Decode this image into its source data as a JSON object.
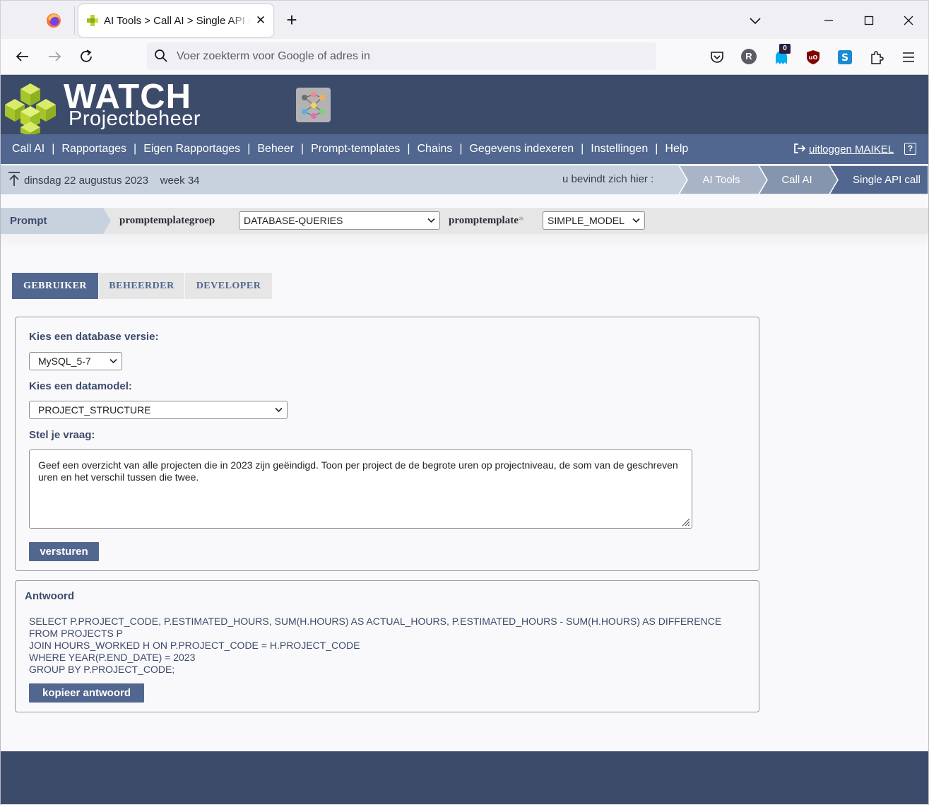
{
  "browser": {
    "tab_title": "AI Tools > Call AI > Single API call",
    "url_placeholder": "Voer zoekterm voor Google of adres in",
    "notification_count": "0",
    "account_initial": "R"
  },
  "header": {
    "logo_title": "WATCH",
    "logo_subtitle": "Projectbeheer"
  },
  "menu": {
    "items": [
      "Call AI",
      "Rapportages",
      "Eigen Rapportages",
      "Beheer",
      "Prompt-templates",
      "Chains",
      "Gegevens indexeren",
      "Instellingen",
      "Help"
    ],
    "logout_label": "uitloggen MAIKEL",
    "help_glyph": "?"
  },
  "crumb_bar": {
    "date": "dinsdag 22 augustus 2023",
    "week": "week 34",
    "here_label": "u bevindt zich hier :",
    "crumbs": [
      "AI Tools",
      "Call AI",
      "Single API call"
    ]
  },
  "prompt_row": {
    "tab_label": "Prompt",
    "group_label": "promptemplategroep",
    "group_value": "DATABASE-QUERIES",
    "template_label": "promptemplate",
    "template_required": "*",
    "template_value": "SIMPLE_MODEL"
  },
  "role_tabs": [
    {
      "label": "GEBRUIKER",
      "active": true
    },
    {
      "label": "BEHEERDER",
      "active": false
    },
    {
      "label": "DEVELOPER",
      "active": false
    }
  ],
  "form": {
    "db_version_label": "Kies een database versie:",
    "db_version_value": "MySQL_5-7",
    "datamodel_label": "Kies een datamodel:",
    "datamodel_value": "PROJECT_STRUCTURE",
    "question_label": "Stel je vraag:",
    "question_text": "Geef een overzicht van alle projecten die in 2023 zijn geëindigd. Toon per project de de begrote uren op projectniveau, de som van de geschreven uren en het verschil tussen die twee.",
    "submit_label": "versturen"
  },
  "answer": {
    "title": "Antwoord",
    "lines": [
      "SELECT P.PROJECT_CODE, P.ESTIMATED_HOURS, SUM(H.HOURS) AS ACTUAL_HOURS, P.ESTIMATED_HOURS - SUM(H.HOURS) AS DIFFERENCE",
      "FROM PROJECTS P",
      "JOIN HOURS_WORKED H ON P.PROJECT_CODE = H.PROJECT_CODE",
      "WHERE YEAR(P.END_DATE) = 2023",
      "GROUP BY P.PROJECT_CODE;"
    ],
    "copy_label": "kopieer antwoord"
  },
  "colors": {
    "header_bg": "#3d4b6b",
    "menu_bg": "#52678f",
    "crumb_bg": "#c8d2df",
    "logo_green": "#b6d531"
  }
}
